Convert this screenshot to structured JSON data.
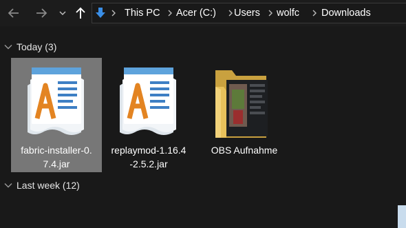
{
  "toolbar": {
    "icons": [
      "back-arrow-icon",
      "forward-arrow-icon",
      "chevron-down-icon",
      "up-arrow-icon"
    ]
  },
  "address": {
    "location_icon": "download-arrow-icon",
    "breadcrumbs": [
      "This PC",
      "Acer (C:)",
      "Users",
      "wolfc",
      "Downloads"
    ]
  },
  "groups": [
    {
      "label": "Today (3)",
      "items": [
        {
          "name_line1": "fabric-installer-0.",
          "name_line2": "7.4.jar",
          "icon": "wordpad-document-icon",
          "selected": true
        },
        {
          "name_line1": "replaymod-1.16.4",
          "name_line2": "-2.5.2.jar",
          "icon": "wordpad-document-icon",
          "selected": false
        },
        {
          "name_line1": "OBS Aufnahme",
          "name_line2": "",
          "icon": "folder-icon",
          "selected": false
        }
      ]
    },
    {
      "label": "Last week (12)"
    }
  ],
  "colors": {
    "background": "#191919",
    "selection": "#777777",
    "accent": "#3a8ee6",
    "folder": "#e8c15b"
  }
}
